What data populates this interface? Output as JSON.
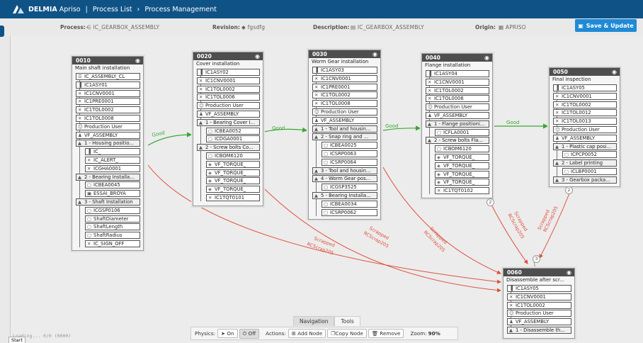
{
  "topbar": {
    "brand": "DELMIA",
    "product": "Apriso",
    "crumbs": [
      "Process List",
      "Process Management"
    ],
    "sep": "›"
  },
  "header": {
    "process_label": "Process:",
    "process_value": "IC_GEARBOX_ASSEMBLY",
    "revision_label": "Revision:",
    "revision_value": "fgsdfg",
    "description_label": "Description:",
    "description_value": "IC_GEARBOX_ASSEMBLY",
    "origin_label": "Origin:",
    "origin_value": "APRISO",
    "save_label": "Save & Update"
  },
  "nodes": [
    {
      "id": "0010",
      "title": "Main shaft installation",
      "items": [
        {
          "icon": "list",
          "text": "IC_ASSEMBLY_CL"
        },
        {
          "icon": "bars",
          "text": "IC1ASY01"
        },
        {
          "icon": "tool",
          "text": "IC1CNV0001"
        },
        {
          "icon": "tool",
          "text": "IC1PRE0001"
        },
        {
          "icon": "tool",
          "text": "IC1TOL0002"
        },
        {
          "icon": "tool",
          "text": "IC1TOL0008"
        },
        {
          "icon": "user",
          "text": "Production User"
        },
        {
          "icon": "users",
          "text": "VF_ASSEMBLY"
        },
        {
          "icon": "tri",
          "text": "1 - Housing positio..."
        },
        {
          "icon": "bars",
          "text": "IC_"
        },
        {
          "icon": "tool",
          "text": "IC_ALERT_"
        },
        {
          "icon": "tool",
          "text": "ICGHA0001"
        },
        {
          "icon": "tri",
          "text": "2 - Bearing Installa..."
        },
        {
          "icon": "doc",
          "text": "ICBEA0045"
        },
        {
          "icon": "img",
          "text": "ESSAI_BROYA"
        },
        {
          "icon": "tri",
          "text": "3 - Shaft Installation"
        },
        {
          "icon": "doc",
          "text": "ICGSP0106"
        },
        {
          "icon": "doc",
          "text": "ShaftDiameter"
        },
        {
          "icon": "doc",
          "text": "ShaftLength"
        },
        {
          "icon": "doc",
          "text": "ShaftRadius"
        },
        {
          "icon": "tool",
          "text": "IC_SIGN_OFF"
        }
      ]
    },
    {
      "id": "0020",
      "title": "Cover installation",
      "items": [
        {
          "icon": "bars",
          "text": "IC1ASY02"
        },
        {
          "icon": "tool",
          "text": "IC1CNV0001"
        },
        {
          "icon": "tool",
          "text": "IC1TOL0002"
        },
        {
          "icon": "tool",
          "text": "IC1TOL0006"
        },
        {
          "icon": "user",
          "text": "Production User"
        },
        {
          "icon": "users",
          "text": "VF_ASSEMBLY"
        },
        {
          "icon": "tri",
          "text": "1 - Bearing Cover I..."
        },
        {
          "icon": "doc",
          "text": "ICBEA0052"
        },
        {
          "icon": "doc",
          "text": "ICDGA0001"
        },
        {
          "icon": "tri",
          "text": "2 - Screw bolts Co..."
        },
        {
          "icon": "doc",
          "text": "ICBOM6120"
        },
        {
          "icon": "eye",
          "text": "VF_TORQUE_"
        },
        {
          "icon": "eye",
          "text": "VF_TORQUE_"
        },
        {
          "icon": "eye",
          "text": "VF_TORQUE_"
        },
        {
          "icon": "eye",
          "text": "VF_TORQUE_"
        },
        {
          "icon": "tool",
          "text": "IC1TQT0101"
        }
      ]
    },
    {
      "id": "0030",
      "title": "Worm Gear installation",
      "items": [
        {
          "icon": "bars",
          "text": "IC1ASY03"
        },
        {
          "icon": "tool",
          "text": "IC1CNV0001"
        },
        {
          "icon": "tool",
          "text": "IC1PRE0001"
        },
        {
          "icon": "tool",
          "text": "IC1TOL0002"
        },
        {
          "icon": "tool",
          "text": "IC1TOL0008"
        },
        {
          "icon": "user",
          "text": "Production User"
        },
        {
          "icon": "users",
          "text": "VF_ASSEMBLY"
        },
        {
          "icon": "tri",
          "text": "1 - Tool and housin..."
        },
        {
          "icon": "tri",
          "text": "2 - Snap ring and ..."
        },
        {
          "icon": "doc",
          "text": "ICBEA0025"
        },
        {
          "icon": "doc",
          "text": "ICSRP0063"
        },
        {
          "icon": "doc",
          "text": "ICSRP0064"
        },
        {
          "icon": "tri",
          "text": "3 - Tool and housin..."
        },
        {
          "icon": "tri",
          "text": "4 - Worm Gear pos..."
        },
        {
          "icon": "doc",
          "text": "ICGSP3525"
        },
        {
          "icon": "tri",
          "text": "5 - Bearing Installa..."
        },
        {
          "icon": "doc",
          "text": "ICBEA0034"
        },
        {
          "icon": "doc",
          "text": "ICSRP0062"
        }
      ]
    },
    {
      "id": "0040",
      "title": "Flange installation",
      "items": [
        {
          "icon": "bars",
          "text": "IC1ASY04"
        },
        {
          "icon": "tool",
          "text": "IC1CNV0001"
        },
        {
          "icon": "tool",
          "text": "IC1TOL0002"
        },
        {
          "icon": "tool",
          "text": "IC1TOL0006"
        },
        {
          "icon": "user",
          "text": "Production User"
        },
        {
          "icon": "users",
          "text": "VF_ASSEMBLY"
        },
        {
          "icon": "tri",
          "text": "1 - Flange positioni..."
        },
        {
          "icon": "doc",
          "text": "ICFLA0001"
        },
        {
          "icon": "tri",
          "text": "2 - Screw bolts Fla..."
        },
        {
          "icon": "doc",
          "text": "ICBOM6120"
        },
        {
          "icon": "eye",
          "text": "VF_TORQUE_"
        },
        {
          "icon": "eye",
          "text": "VF_TORQUE_"
        },
        {
          "icon": "eye",
          "text": "VF_TORQUE_"
        },
        {
          "icon": "eye",
          "text": "VF_TORQUE_"
        },
        {
          "icon": "tool",
          "text": "IC1TQT0102"
        }
      ]
    },
    {
      "id": "0050",
      "title": "Final inspection",
      "items": [
        {
          "icon": "bars",
          "text": "IC1ASY05"
        },
        {
          "icon": "tool",
          "text": "IC1CNV0001"
        },
        {
          "icon": "tool",
          "text": "IC1TOL0002"
        },
        {
          "icon": "tool",
          "text": "IC1TOL0012"
        },
        {
          "icon": "tool",
          "text": "IC1TOL0013"
        },
        {
          "icon": "user",
          "text": "Production User"
        },
        {
          "icon": "users",
          "text": "VF_ASSEMBLY"
        },
        {
          "icon": "tri",
          "text": "1 - Plastic cap posi..."
        },
        {
          "icon": "doc",
          "text": "ICPCP0052"
        },
        {
          "icon": "tri",
          "text": "2 - Label printing"
        },
        {
          "icon": "doc",
          "text": "ICLBP0001"
        },
        {
          "icon": "tri",
          "text": "3 - Gearbox packa..."
        }
      ]
    },
    {
      "id": "0060",
      "title": "Disassemble after scr...",
      "items": [
        {
          "icon": "bars",
          "text": "IC1ASY05"
        },
        {
          "icon": "tool",
          "text": "IC1CNV0001"
        },
        {
          "icon": "tool",
          "text": "IC1TOL0002"
        },
        {
          "icon": "user",
          "text": "Production User"
        },
        {
          "icon": "users",
          "text": "VF_ASSEMBLY"
        },
        {
          "icon": "tri",
          "text": "1 - Disassemble th..."
        }
      ]
    }
  ],
  "edges": {
    "good_label": "Good",
    "scrapped_label": "Scrapped",
    "scrap_code": "RCScrap205",
    "counts": [
      "2",
      "2",
      "3"
    ]
  },
  "bottom": {
    "tabs": [
      "Navigation",
      "Tools"
    ],
    "physics_label": "Physics:",
    "on_label": "On",
    "off_label": "Off",
    "actions_label": "Actions:",
    "add_node": "Add Node",
    "copy_node": "Copy Node",
    "remove": "Remove",
    "zoom_label": "Zoom:",
    "zoom_value": "90%"
  },
  "status_text": "Loading... 0/0 (0000)",
  "start_label": "Start",
  "colors": {
    "topbar": "#0f5386",
    "good": "#3aa832",
    "scrapped": "#e0503c",
    "save": "#1f8ad6"
  }
}
